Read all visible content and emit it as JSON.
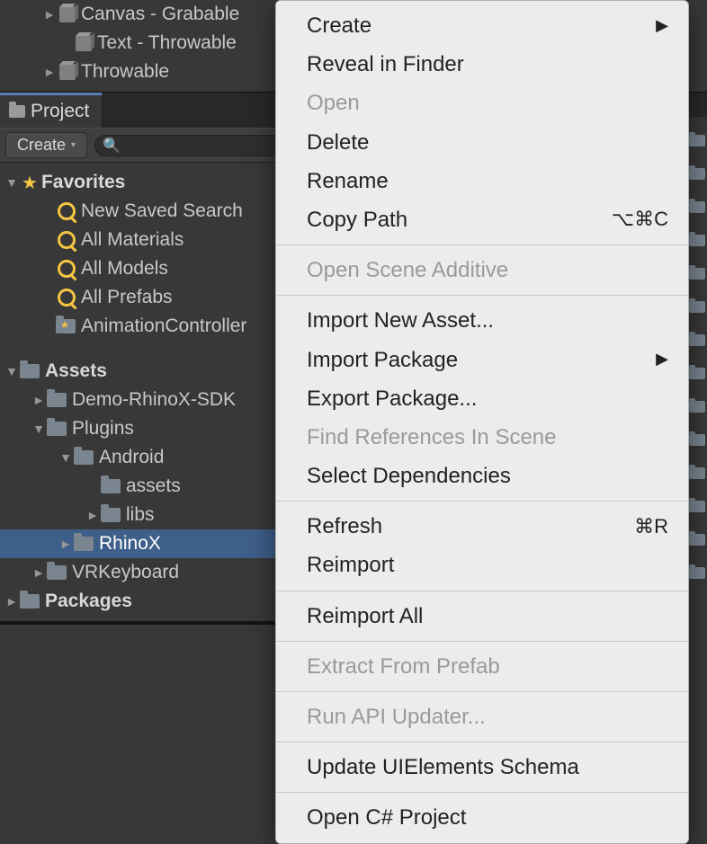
{
  "hierarchy": [
    {
      "label": "Canvas  - Grabable",
      "indent": 48,
      "arrow": true
    },
    {
      "label": "Text - Throwable",
      "indent": 66,
      "arrow": false
    },
    {
      "label": "Throwable",
      "indent": 48,
      "arrow": true
    }
  ],
  "tab_label": "Project",
  "toolbar": {
    "create_label": "Create"
  },
  "favorites": {
    "title": "Favorites",
    "items": [
      "New Saved Search",
      "All Materials",
      "All Models",
      "All Prefabs"
    ],
    "controller": "AnimationController"
  },
  "assets": {
    "title": "Assets",
    "items": [
      {
        "label": "Demo-RhinoX-SDK",
        "depth": 1,
        "arrow": "►",
        "selected": false
      },
      {
        "label": "Plugins",
        "depth": 1,
        "arrow": "▼",
        "selected": false
      },
      {
        "label": "Android",
        "depth": 2,
        "arrow": "▼",
        "selected": false
      },
      {
        "label": "assets",
        "depth": 3,
        "arrow": "",
        "selected": false
      },
      {
        "label": "libs",
        "depth": 3,
        "arrow": "►",
        "selected": false
      },
      {
        "label": "RhinoX",
        "depth": 2,
        "arrow": "►",
        "selected": true
      },
      {
        "label": "VRKeyboard",
        "depth": 1,
        "arrow": "►",
        "selected": false
      }
    ],
    "packages": "Packages"
  },
  "menu": [
    {
      "label": "Create",
      "submenu": true
    },
    {
      "label": "Reveal in Finder"
    },
    {
      "label": "Open",
      "disabled": true
    },
    {
      "label": "Delete"
    },
    {
      "label": "Rename"
    },
    {
      "label": "Copy Path",
      "shortcut": "⌥⌘C"
    },
    {
      "sep": true
    },
    {
      "label": "Open Scene Additive",
      "disabled": true
    },
    {
      "sep": true
    },
    {
      "label": "Import New Asset..."
    },
    {
      "label": "Import Package",
      "submenu": true
    },
    {
      "label": "Export Package..."
    },
    {
      "label": "Find References In Scene",
      "disabled": true
    },
    {
      "label": "Select Dependencies"
    },
    {
      "sep": true
    },
    {
      "label": "Refresh",
      "shortcut": "⌘R"
    },
    {
      "label": "Reimport"
    },
    {
      "sep": true
    },
    {
      "label": "Reimport All"
    },
    {
      "sep": true
    },
    {
      "label": "Extract From Prefab",
      "disabled": true
    },
    {
      "sep": true
    },
    {
      "label": "Run API Updater...",
      "disabled": true
    },
    {
      "sep": true
    },
    {
      "label": "Update UIElements Schema"
    },
    {
      "sep": true
    },
    {
      "label": "Open C# Project"
    }
  ]
}
